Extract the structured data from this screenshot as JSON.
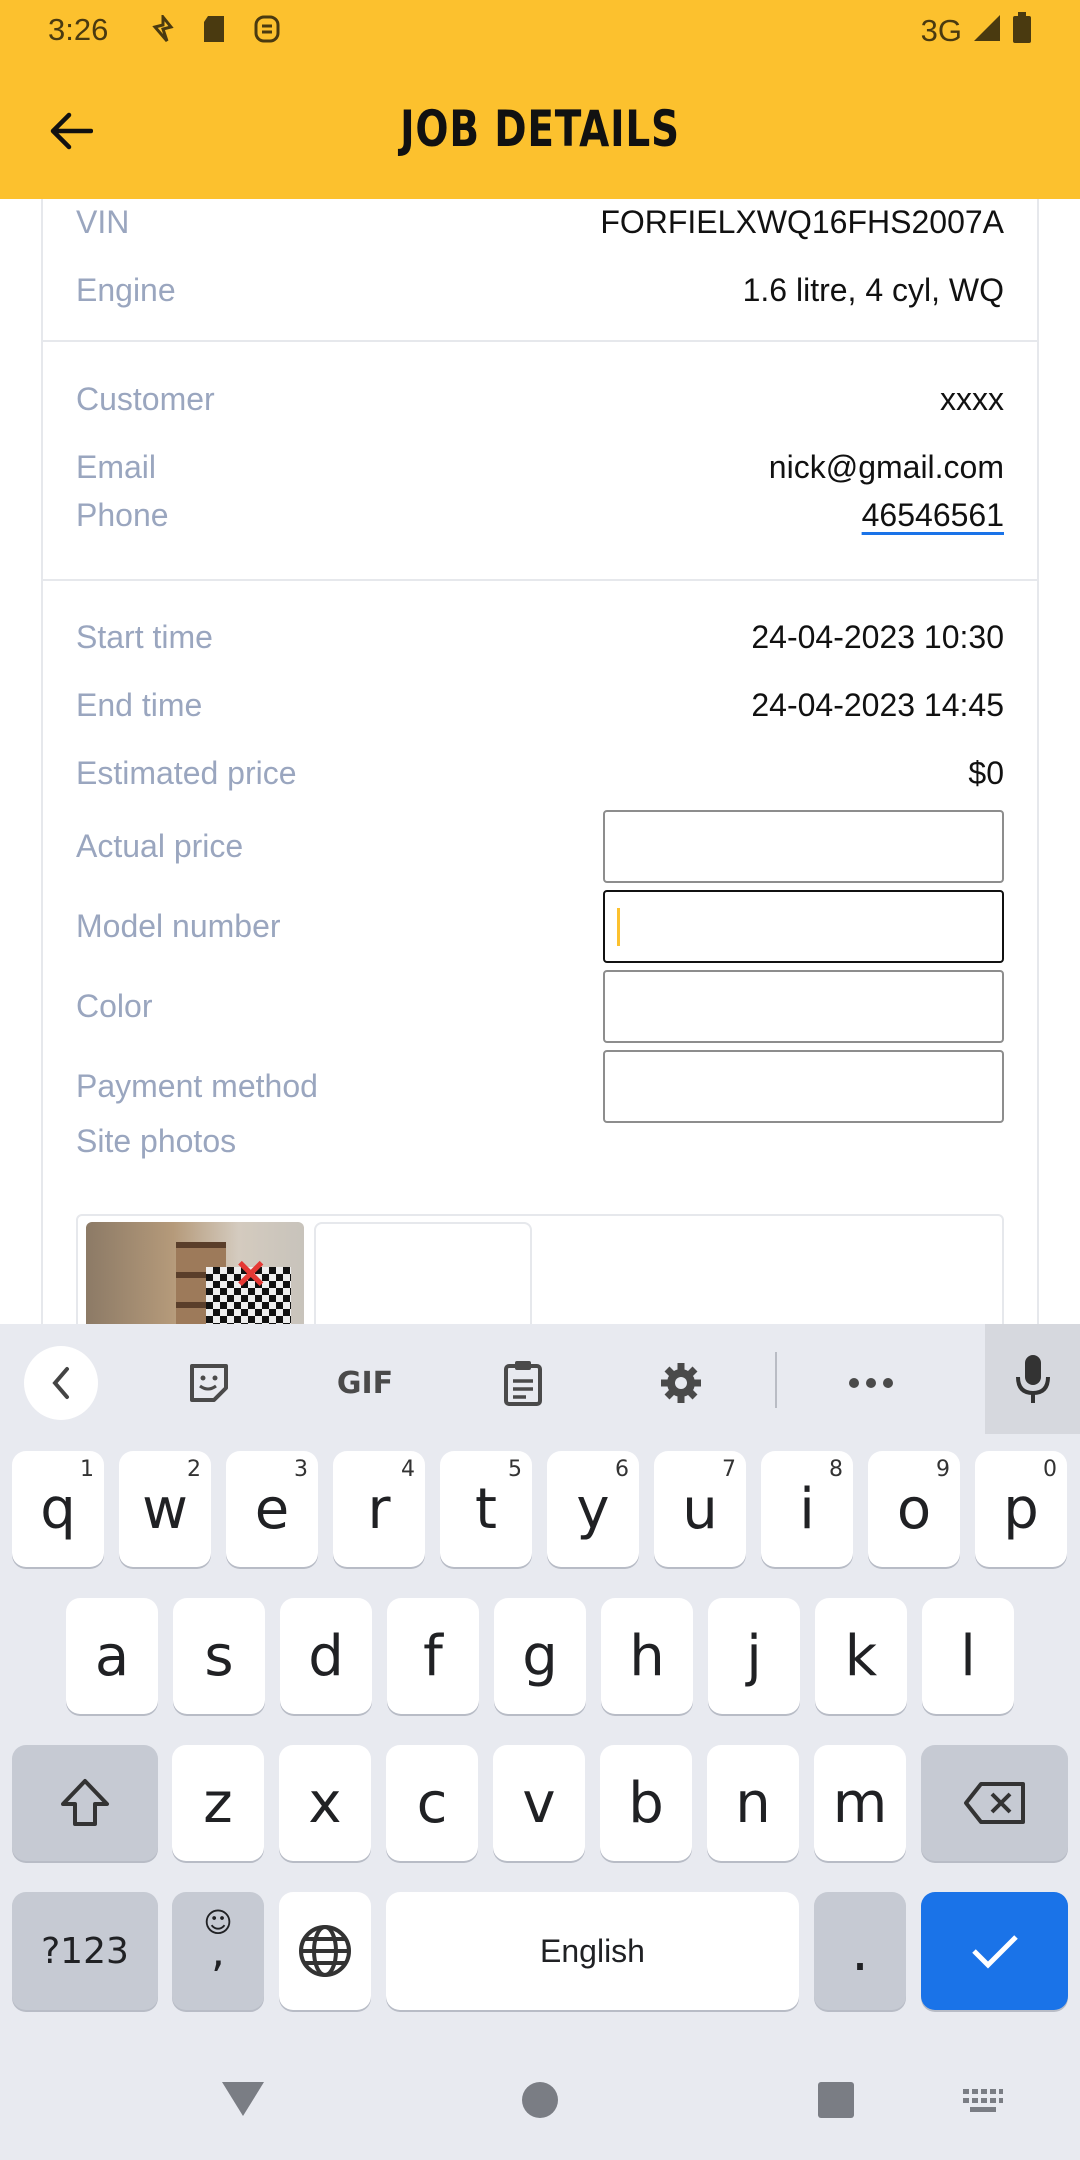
{
  "status_bar": {
    "time": "3:26",
    "network": "3G"
  },
  "app_bar": {
    "title": "JOB DETAILS"
  },
  "vehicle": [
    {
      "label": "VIN",
      "value": "FORFIELXWQ16FHS2007A"
    },
    {
      "label": "Engine",
      "value": "1.6 litre, 4 cyl, WQ"
    }
  ],
  "customer": {
    "customer_label": "Customer",
    "customer_value": "xxxx",
    "email_label": "Email",
    "email_value": "nick@gmail.com",
    "phone_label": "Phone",
    "phone_value": "46546561"
  },
  "job": {
    "start_label": "Start time",
    "start_value": "24-04-2023 10:30",
    "end_label": "End time",
    "end_value": "24-04-2023 14:45",
    "est_label": "Estimated price",
    "est_value": "$0",
    "actual_label": "Actual price",
    "actual_value": "",
    "model_label": "Model number",
    "model_value": "",
    "color_label": "Color",
    "color_value": "",
    "payment_label": "Payment method",
    "payment_value": "",
    "photos_label": "Site photos"
  },
  "keyboard": {
    "toolbar": {
      "gif": "GIF"
    },
    "row1": [
      {
        "k": "q",
        "s": "1"
      },
      {
        "k": "w",
        "s": "2"
      },
      {
        "k": "e",
        "s": "3"
      },
      {
        "k": "r",
        "s": "4"
      },
      {
        "k": "t",
        "s": "5"
      },
      {
        "k": "y",
        "s": "6"
      },
      {
        "k": "u",
        "s": "7"
      },
      {
        "k": "i",
        "s": "8"
      },
      {
        "k": "o",
        "s": "9"
      },
      {
        "k": "p",
        "s": "0"
      }
    ],
    "row2": [
      "a",
      "s",
      "d",
      "f",
      "g",
      "h",
      "j",
      "k",
      "l"
    ],
    "row3": [
      "z",
      "x",
      "c",
      "v",
      "b",
      "n",
      "m"
    ],
    "symbols_label": "?123",
    "comma_label": ",",
    "space_label": "English",
    "period_label": "."
  },
  "colors": {
    "accent": "#FCC12E",
    "enter": "#1A73E8",
    "label": "#9aa6bf"
  }
}
